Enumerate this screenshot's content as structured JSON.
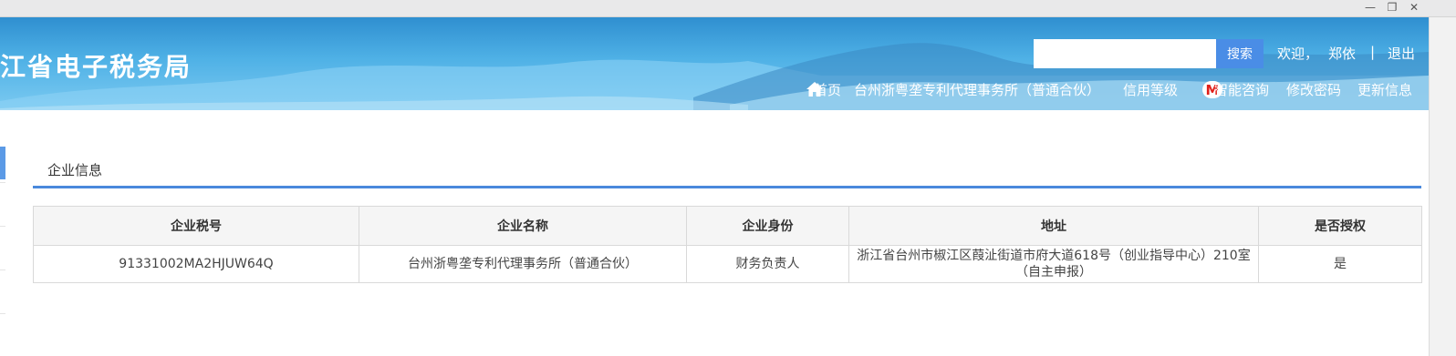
{
  "window": {
    "minimize_glyph": "—",
    "restore_glyph": "❐",
    "close_glyph": "✕"
  },
  "header": {
    "site_title": "江省电子税务局",
    "search": {
      "placeholder": "",
      "button_label": "搜索"
    },
    "user": {
      "welcome": "欢迎，",
      "name": "郑依",
      "separator": "|",
      "logout": "退出"
    },
    "nav": {
      "home": "首页",
      "company": "台州浙粤垄专利代理事务所（普通合伙）",
      "credit_level": "信用等级",
      "credit_badge": "M",
      "smart_consult": "智能咨询",
      "change_password": "修改密码",
      "update_info": "更新信息"
    }
  },
  "main": {
    "tab_title": "企业信息",
    "table": {
      "headers": [
        "企业税号",
        "企业名称",
        "企业身份",
        "地址",
        "是否授权"
      ],
      "rows": [
        [
          "91331002MA2HJUW64Q",
          "台州浙粤垄专利代理事务所（普通合伙）",
          "财务负责人",
          "浙江省台州市椒江区葭沚街道市府大道618号（创业指导中心）210室（自主申报）",
          "是"
        ]
      ]
    }
  },
  "colors": {
    "accent": "#4a89dc",
    "search_button": "#4a8de6",
    "badge_text": "#e0201a"
  }
}
